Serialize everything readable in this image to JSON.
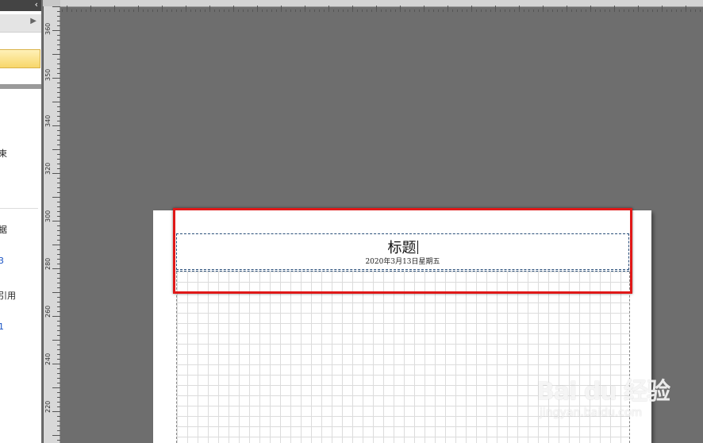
{
  "side_panel": {
    "texts": [
      "束",
      "据",
      "3",
      "引用",
      "1"
    ]
  },
  "ruler": {
    "labels": [
      "360",
      "350",
      "340",
      "320",
      "300",
      "280",
      "260",
      "240",
      "220"
    ]
  },
  "document": {
    "title": "标题",
    "date": "2020年3月13日星期五"
  },
  "watermark": {
    "main": "Bai du 经验",
    "sub": "jingyan.baidu.com"
  },
  "colors": {
    "highlight": "#e01818",
    "workspace": "#6e6e6e",
    "selected_item": "#f7d66a"
  }
}
